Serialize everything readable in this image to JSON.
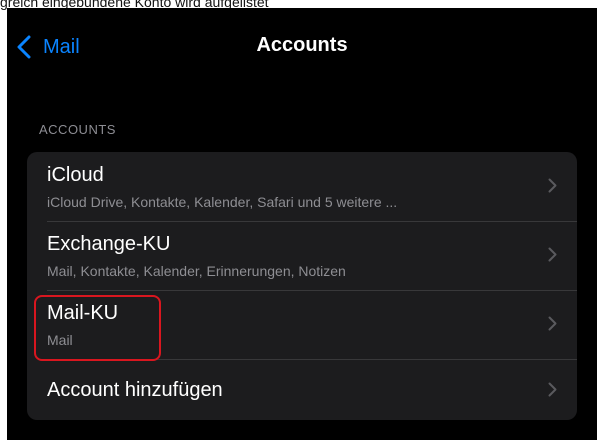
{
  "caption": "greich eingebundene Konto wird aufgelistet",
  "navbar": {
    "back_label": "Mail",
    "title": "Accounts"
  },
  "section": {
    "header": "ACCOUNTS"
  },
  "accounts": [
    {
      "title": "iCloud",
      "subtitle": "iCloud Drive, Kontakte, Kalender, Safari und 5 weitere ..."
    },
    {
      "title": "Exchange-KU",
      "subtitle": "Mail, Kontakte, Kalender, Erinnerungen, Notizen"
    },
    {
      "title": "Mail-KU",
      "subtitle": "Mail"
    }
  ],
  "add_account_label": "Account hinzufügen",
  "colors": {
    "accent": "#0a84ff",
    "highlight": "#d9161f",
    "background": "#000000",
    "group": "#1c1c1e"
  },
  "icons": [
    "chevron-left-icon",
    "chevron-right-icon"
  ]
}
